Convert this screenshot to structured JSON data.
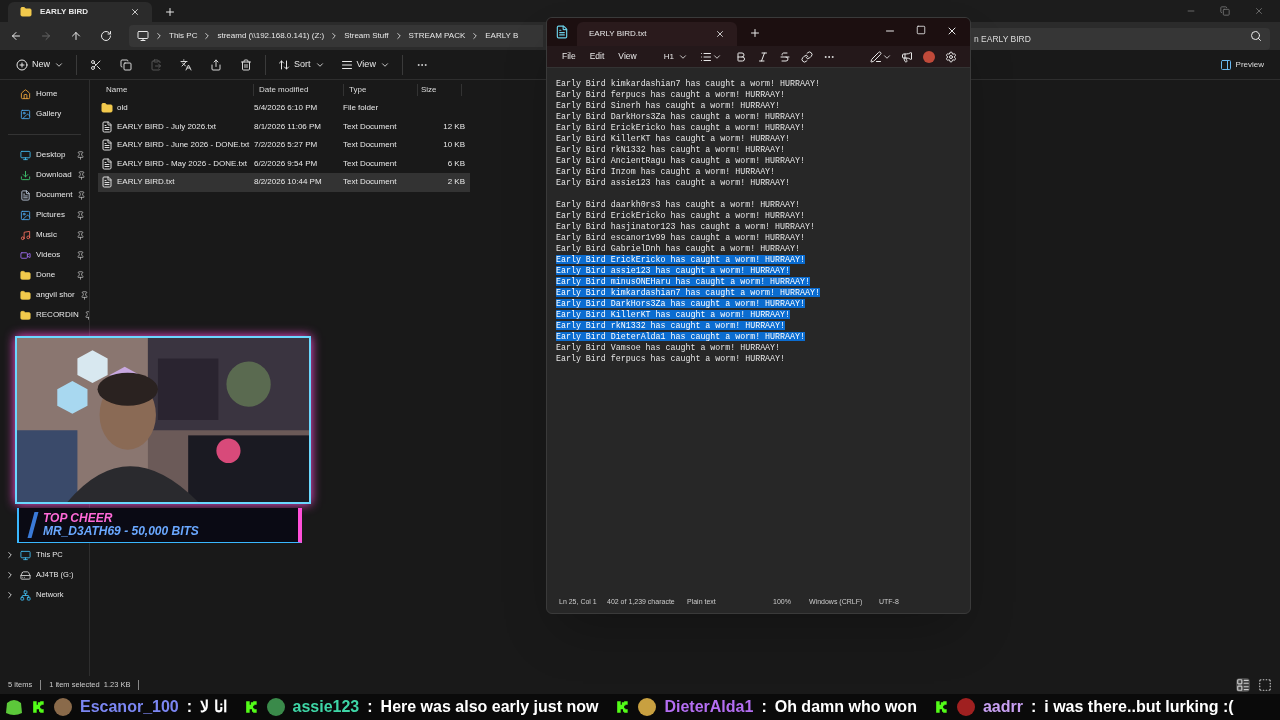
{
  "explorer": {
    "tab": {
      "title": "EARLY BIRD"
    },
    "breadcrumbs": [
      "This PC",
      "streamd (\\\\192.168.0.141) (Z:)",
      "Stream Stuff",
      "STREAM PACK",
      "EARLY B"
    ],
    "search": {
      "placeholder": "n EARLY BIRD"
    },
    "toolbar": [
      {
        "kind": "new",
        "label": "New"
      },
      {
        "kind": "cut"
      },
      {
        "kind": "copy"
      },
      {
        "kind": "paste",
        "disabled": true
      },
      {
        "kind": "rename"
      },
      {
        "kind": "share"
      },
      {
        "kind": "delete"
      },
      {
        "kind": "sort",
        "label": "Sort"
      },
      {
        "kind": "view",
        "label": "View"
      },
      {
        "kind": "more"
      }
    ],
    "preview": "Preview",
    "sidebar": {
      "quick": [
        {
          "kind": "home",
          "label": "Home",
          "pinned": false
        },
        {
          "kind": "gallery",
          "label": "Gallery",
          "pinned": false
        }
      ],
      "pinned": [
        {
          "kind": "desktop",
          "label": "Desktop",
          "pinned": true
        },
        {
          "kind": "download",
          "label": "Download",
          "pinned": true
        },
        {
          "kind": "document",
          "label": "Document",
          "pinned": true
        },
        {
          "kind": "pictures",
          "label": "Pictures",
          "pinned": true
        },
        {
          "kind": "music",
          "label": "Music",
          "pinned": true
        },
        {
          "kind": "videos",
          "label": "Videos",
          "pinned": true
        },
        {
          "kind": "folder",
          "label": "Done",
          "pinned": true
        },
        {
          "kind": "folder",
          "label": "angvil shor",
          "pinned": true
        },
        {
          "kind": "folder",
          "label": "RECORDIN",
          "pinned": true
        }
      ],
      "drives": [
        {
          "kind": "pc",
          "label": "This PC",
          "expanded": false
        },
        {
          "kind": "drive",
          "label": "AJ4TB (G:)",
          "expanded": false
        },
        {
          "kind": "network",
          "label": "Network",
          "expanded": false
        }
      ]
    },
    "columns": [
      "Name",
      "Date modified",
      "Type",
      "Size"
    ],
    "rows": [
      {
        "kind": "folder",
        "name": "old",
        "date": "5/4/2026 6:10 PM",
        "type": "File folder",
        "selected": false
      },
      {
        "kind": "text",
        "name": "EARLY BIRD - July 2026.txt",
        "date": "8/1/2026 11:06 PM",
        "type": "Text Document",
        "size": "12 KB",
        "selected": false
      },
      {
        "kind": "text",
        "name": "EARLY BIRD - June 2026 - DONE.txt",
        "date": "7/2/2026 5:27 PM",
        "type": "Text Document",
        "size": "10 KB",
        "selected": false
      },
      {
        "kind": "text",
        "name": "EARLY BIRD - May 2026 - DONE.txt",
        "date": "6/2/2026 9:54 PM",
        "type": "Text Document",
        "size": "6 KB",
        "selected": false
      },
      {
        "kind": "text",
        "name": "EARLY BIRD.txt",
        "date": "8/2/2026 10:44 PM",
        "type": "Text Document",
        "size": "2 KB",
        "selected": true
      }
    ],
    "status": [
      "5 items",
      "1 item selected  1.23 KB"
    ]
  },
  "notepad": {
    "tab": {
      "title": "EARLY BIRD.txt"
    },
    "menu": [
      "File",
      "Edit",
      "View"
    ],
    "heading": "H1",
    "blocks": [
      [
        {
          "text": "Early Bird kimkardashian7 has caught a worm! HURRAAY!",
          "selected": false
        },
        {
          "text": "Early Bird ferpucs has caught a worm! HURRAAY!",
          "selected": false
        },
        {
          "text": "Early Bird Sinerh has caught a worm! HURRAAY!",
          "selected": false
        },
        {
          "text": "Early Bird DarkHors3Za has caught a worm! HURRAAY!",
          "selected": false
        },
        {
          "text": "Early Bird ErickEricko has caught a worm! HURRAAY!",
          "selected": false
        },
        {
          "text": "Early Bird KillerKT has caught a worm! HURRAAY!",
          "selected": false
        },
        {
          "text": "Early Bird rkN1332 has caught a worm! HURRAAY!",
          "selected": false
        },
        {
          "text": "Early Bird AncientRagu has caught a worm! HURRAAY!",
          "selected": false
        },
        {
          "text": "Early Bird Inzom has caught a worm! HURRAAY!",
          "selected": false
        },
        {
          "text": "Early Bird assie123 has caught a worm! HURRAAY!",
          "selected": false
        }
      ],
      [
        {
          "text": "Early Bird daarkh0rs3 has caught a worm! HURRAAY!",
          "selected": false
        },
        {
          "text": "Early Bird ErickEricko has caught a worm! HURRAAY!",
          "selected": false
        },
        {
          "text": "Early Bird hasjinator123 has caught a worm! HURRAAY!",
          "selected": false
        },
        {
          "text": "Early Bird escanor1v99 has caught a worm! HURRAAY!",
          "selected": false
        },
        {
          "text": "Early Bird GabrielDnh has caught a worm! HURRAAY!",
          "selected": false
        },
        {
          "text": "Early Bird ErickEricko has caught a worm! HURRAAY!",
          "selected": true
        },
        {
          "text": "Early Bird assie123 has caught a worm! HURRAAY!",
          "selected": true
        },
        {
          "text": "Early Bird minusONEHaru has caught a worm! HURRAAY!",
          "selected": true
        },
        {
          "text": "Early Bird kimkardashian7 has caught a worm! HURRAAY!",
          "selected": true
        },
        {
          "text": "Early Bird DarkHors3Za has caught a worm! HURRAAY!",
          "selected": true
        },
        {
          "text": "Early Bird KillerKT has caught a worm! HURRAAY!",
          "selected": true
        },
        {
          "text": "Early Bird rkN1332 has caught a worm! HURRAAY!",
          "selected": true
        },
        {
          "text": "Early Bird DieterAlda1 has caught a worm! HURRAAY!",
          "selected": true
        },
        {
          "text": "Early Bird Vamsoe has caught a worm! HURRAAY!",
          "selected": false
        },
        {
          "text": "Early Bird ferpucs has caught a worm! HURRAAY!",
          "selected": false
        }
      ]
    ],
    "status": [
      "Ln 25, Col 1",
      "402 of 1,239 characte",
      "Plain text",
      "100%",
      "Windows (CRLF)",
      "UTF-8"
    ]
  },
  "overlay": {
    "cheer_title": "TOP CHEER",
    "cheer_line": "MR_D3ATH69 - 50,000 BITS"
  },
  "chat": [
    {
      "user": "Escanor_100",
      "color": "#7b86f2",
      "separator": ":",
      "message": "انا لا"
    },
    {
      "user": "assie123",
      "color": "#3ed6a6",
      "separator": ":",
      "message": "Here was also early just now"
    },
    {
      "user": "DieterAlda1",
      "color": "#b46ef2",
      "separator": ":",
      "message": "Oh damn who won"
    },
    {
      "user": "aadrr",
      "color": "#c8a0f2",
      "separator": ":",
      "message": "i was there..but lurking :("
    }
  ]
}
